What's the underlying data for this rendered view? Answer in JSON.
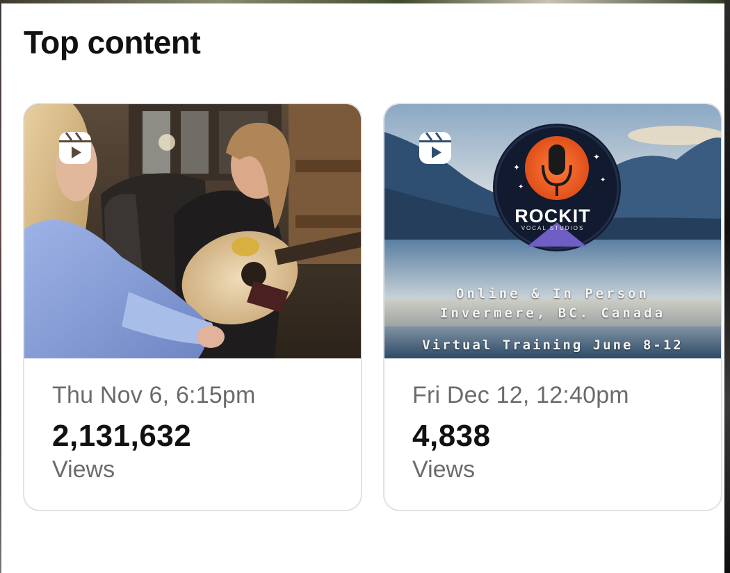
{
  "section": {
    "title": "Top content"
  },
  "cards": [
    {
      "date": "Thu Nov 6, 6:15pm",
      "count": "2,131,632",
      "metric": "Views",
      "media_type_icon": "reel-icon"
    },
    {
      "date": "Fri Dec 12, 12:40pm",
      "count": "4,838",
      "metric": "Views",
      "media_type_icon": "reel-icon",
      "thumbnail_text": {
        "logo": "ROCKIT",
        "logo_sub": "VOCAL STUDIOS",
        "line1": "Online & In Person",
        "line2": "Invermere, BC. Canada",
        "line3": "Virtual Training June 8-12"
      }
    }
  ],
  "colors": {
    "text_primary": "#111111",
    "text_secondary": "#6b6b6b",
    "card_border": "#e2e2e2"
  }
}
